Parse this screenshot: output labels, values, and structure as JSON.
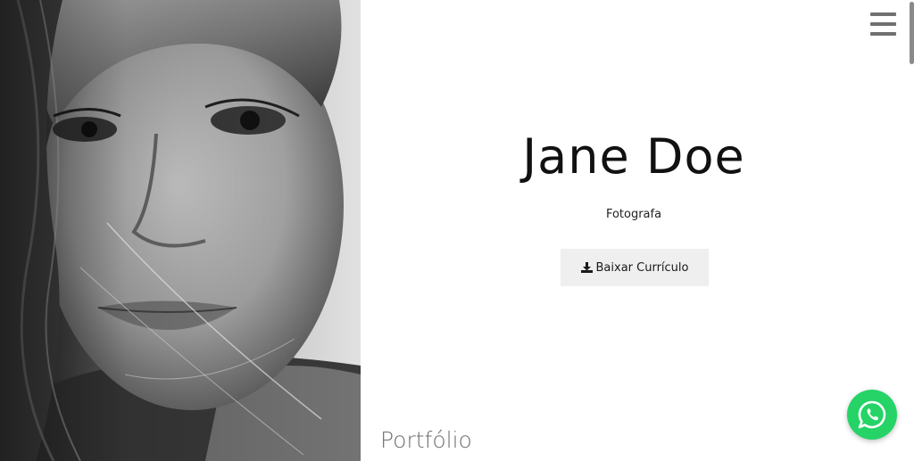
{
  "hero": {
    "name": "Jane Doe",
    "role": "Fotografa",
    "cv_button_label": "Baixar Currículo",
    "cv_button_icon": "download-icon"
  },
  "portfolio": {
    "title": "Portfólio"
  },
  "nav": {
    "menu_icon": "hamburger-menu-icon"
  },
  "floating": {
    "whatsapp_icon": "whatsapp-icon",
    "whatsapp_color": "#25d366"
  },
  "photo": {
    "subject": "black-and-white portrait photograph"
  },
  "colors": {
    "button_bg": "#efefef",
    "title_gray": "#6f6f6f",
    "menu_gray": "#707070"
  }
}
